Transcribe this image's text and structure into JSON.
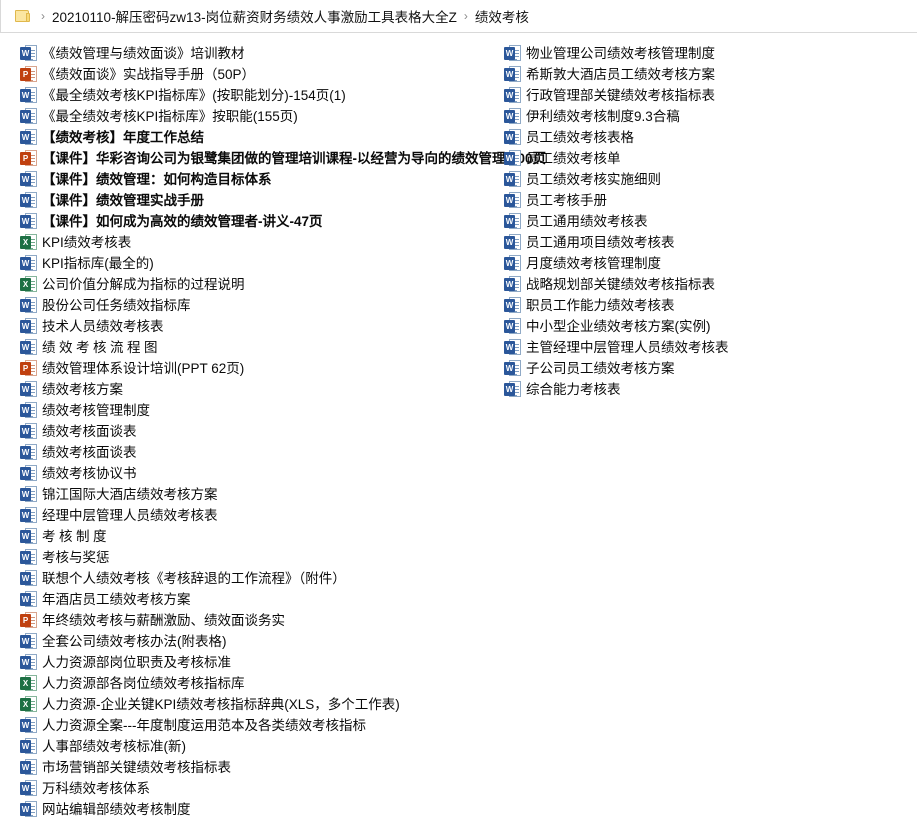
{
  "breadcrumb": {
    "folder_icon": "folder-icon",
    "separator": "›",
    "items": [
      "20210110-解压密码zw13-岗位薪资财务绩效人事激励工具表格大全Z",
      "绩效考核"
    ]
  },
  "icon_letters": {
    "word": "W",
    "excel": "X",
    "ppt": "P"
  },
  "colors": {
    "word": "#2b579a",
    "excel": "#1d7044",
    "ppt": "#c0400f",
    "folder": "#fbe6a2",
    "separator_line": "#d9d9d9",
    "text": "#0a0a0a"
  },
  "files": {
    "left_column": [
      {
        "name": "《绩效管理与绩效面谈》培训教材",
        "type": "word",
        "bold": false,
        "spaced": false
      },
      {
        "name": "《绩效面谈》实战指导手册（50P）",
        "type": "ppt",
        "bold": false,
        "spaced": false
      },
      {
        "name": "《最全绩效考核KPI指标库》(按职能划分)-154页(1)",
        "type": "word",
        "bold": false,
        "spaced": false
      },
      {
        "name": "《最全绩效考核KPI指标库》按职能(155页)",
        "type": "word",
        "bold": false,
        "spaced": false
      },
      {
        "name": "【绩效考核】年度工作总结",
        "type": "word",
        "bold": true,
        "spaced": false
      },
      {
        "name": "【课件】华彩咨询公司为银鹭集团做的管理培训课程-以经营为导向的绩效管理-100页",
        "type": "ppt",
        "bold": true,
        "spaced": false
      },
      {
        "name": "【课件】绩效管理：如何构造目标体系",
        "type": "word",
        "bold": true,
        "spaced": false
      },
      {
        "name": "【课件】绩效管理实战手册",
        "type": "word",
        "bold": true,
        "spaced": false
      },
      {
        "name": "【课件】如何成为高效的绩效管理者-讲义-47页",
        "type": "word",
        "bold": true,
        "spaced": false
      },
      {
        "name": "KPI绩效考核表",
        "type": "excel",
        "bold": false,
        "spaced": false
      },
      {
        "name": "KPI指标库(最全的)",
        "type": "word",
        "bold": false,
        "spaced": false
      },
      {
        "name": "公司价值分解成为指标的过程说明",
        "type": "excel",
        "bold": false,
        "spaced": false
      },
      {
        "name": "股份公司任务绩效指标库",
        "type": "word",
        "bold": false,
        "spaced": false
      },
      {
        "name": "技术人员绩效考核表",
        "type": "word",
        "bold": false,
        "spaced": false
      },
      {
        "name": "绩效考核流程图",
        "type": "word",
        "bold": false,
        "spaced": true
      },
      {
        "name": "绩效管理体系设计培训(PPT 62页)",
        "type": "ppt",
        "bold": false,
        "spaced": false
      },
      {
        "name": "绩效考核方案",
        "type": "word",
        "bold": false,
        "spaced": false
      },
      {
        "name": "绩效考核管理制度",
        "type": "word",
        "bold": false,
        "spaced": false
      },
      {
        "name": "绩效考核面谈表",
        "type": "word",
        "bold": false,
        "spaced": false
      },
      {
        "name": "绩效考核面谈表",
        "type": "word",
        "bold": false,
        "spaced": false
      },
      {
        "name": "绩效考核协议书",
        "type": "word",
        "bold": false,
        "spaced": false
      },
      {
        "name": "锦江国际大酒店绩效考核方案",
        "type": "word",
        "bold": false,
        "spaced": false
      },
      {
        "name": "经理中层管理人员绩效考核表",
        "type": "word",
        "bold": false,
        "spaced": false
      },
      {
        "name": "考核制度",
        "type": "word",
        "bold": false,
        "spaced": true
      },
      {
        "name": "考核与奖惩",
        "type": "word",
        "bold": false,
        "spaced": false
      },
      {
        "name": "联想个人绩效考核《考核辞退的工作流程》（附件）",
        "type": "word",
        "bold": false,
        "spaced": false
      },
      {
        "name": "年酒店员工绩效考核方案",
        "type": "word",
        "bold": false,
        "spaced": false
      },
      {
        "name": "年终绩效考核与薪酬激励、绩效面谈务实",
        "type": "ppt",
        "bold": false,
        "spaced": false
      },
      {
        "name": "全套公司绩效考核办法(附表格)",
        "type": "word",
        "bold": false,
        "spaced": false
      },
      {
        "name": "人力资源部岗位职责及考核标准",
        "type": "word",
        "bold": false,
        "spaced": false
      },
      {
        "name": "人力资源部各岗位绩效考核指标库",
        "type": "excel",
        "bold": false,
        "spaced": false
      },
      {
        "name": "人力资源-企业关键KPI绩效考核指标辞典(XLS，多个工作表)",
        "type": "excel",
        "bold": false,
        "spaced": false
      },
      {
        "name": "人力资源全案---年度制度运用范本及各类绩效考核指标",
        "type": "word",
        "bold": false,
        "spaced": false
      },
      {
        "name": "人事部绩效考核标准(新)",
        "type": "word",
        "bold": false,
        "spaced": false
      },
      {
        "name": "市场营销部关键绩效考核指标表",
        "type": "word",
        "bold": false,
        "spaced": false
      },
      {
        "name": "万科绩效考核体系",
        "type": "word",
        "bold": false,
        "spaced": false
      },
      {
        "name": "网站编辑部绩效考核制度",
        "type": "word",
        "bold": false,
        "spaced": false
      }
    ],
    "right_column": [
      {
        "name": "物业管理公司绩效考核管理制度",
        "type": "word",
        "bold": false,
        "spaced": false
      },
      {
        "name": "希斯敦大酒店员工绩效考核方案",
        "type": "word",
        "bold": false,
        "spaced": false
      },
      {
        "name": "行政管理部关键绩效考核指标表",
        "type": "word",
        "bold": false,
        "spaced": false
      },
      {
        "name": "伊利绩效考核制度9.3合稿",
        "type": "word",
        "bold": false,
        "spaced": false
      },
      {
        "name": "员工绩效考核表格",
        "type": "word",
        "bold": false,
        "spaced": false
      },
      {
        "name": "员工绩效考核单",
        "type": "word",
        "bold": false,
        "spaced": false
      },
      {
        "name": "员工绩效考核实施细则",
        "type": "word",
        "bold": false,
        "spaced": false
      },
      {
        "name": "员工考核手册",
        "type": "word",
        "bold": false,
        "spaced": false
      },
      {
        "name": "员工通用绩效考核表",
        "type": "word",
        "bold": false,
        "spaced": false
      },
      {
        "name": "员工通用项目绩效考核表",
        "type": "word",
        "bold": false,
        "spaced": false
      },
      {
        "name": "月度绩效考核管理制度",
        "type": "word",
        "bold": false,
        "spaced": false
      },
      {
        "name": "战略规划部关键绩效考核指标表",
        "type": "word",
        "bold": false,
        "spaced": false
      },
      {
        "name": "职员工作能力绩效考核表",
        "type": "word",
        "bold": false,
        "spaced": false
      },
      {
        "name": "中小型企业绩效考核方案(实例)",
        "type": "word",
        "bold": false,
        "spaced": false
      },
      {
        "name": "主管经理中层管理人员绩效考核表",
        "type": "word",
        "bold": false,
        "spaced": false
      },
      {
        "name": "子公司员工绩效考核方案",
        "type": "word",
        "bold": false,
        "spaced": false
      },
      {
        "name": "综合能力考核表",
        "type": "word",
        "bold": false,
        "spaced": false
      }
    ]
  }
}
